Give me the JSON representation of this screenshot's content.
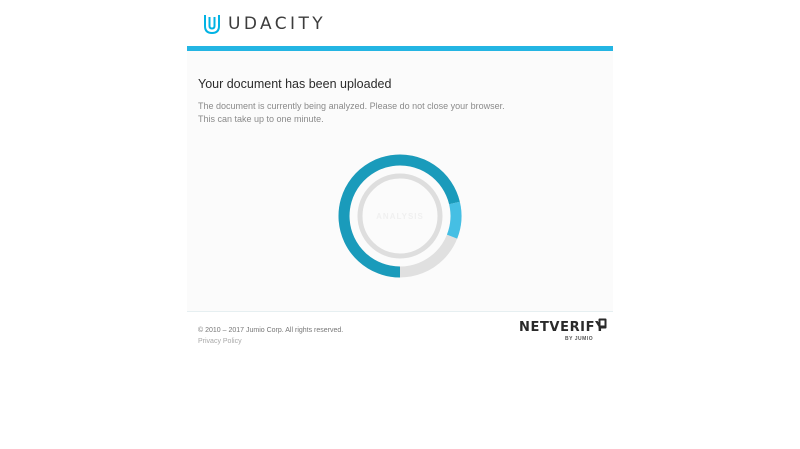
{
  "header": {
    "brand_name": "UDACITY",
    "logo_icon": "udacity-u-icon",
    "logo_color": "#02b3e4"
  },
  "card": {
    "accent_color": "#24b5e3",
    "title": "Your document has been uploaded",
    "message_lines": [
      "The document is currently being analyzed. Please do not close your browser.",
      "This can take up to one minute."
    ]
  },
  "progress": {
    "label": "ANALYSIS",
    "fraction": 0.81,
    "primary_color": "#1a9bbb",
    "highlight_color": "#45bfe4",
    "track_color": "#e0e0e0",
    "inner_ring_color": "#dedede"
  },
  "footer": {
    "copyright": "© 2010 – 2017 Jumio Corp. All rights reserved.",
    "privacy_link": "Privacy Policy",
    "vendor_logo": {
      "name": "NETVERIFY",
      "byline": "BY JUMIO",
      "badge_icon": "jumio-badge-icon"
    }
  }
}
